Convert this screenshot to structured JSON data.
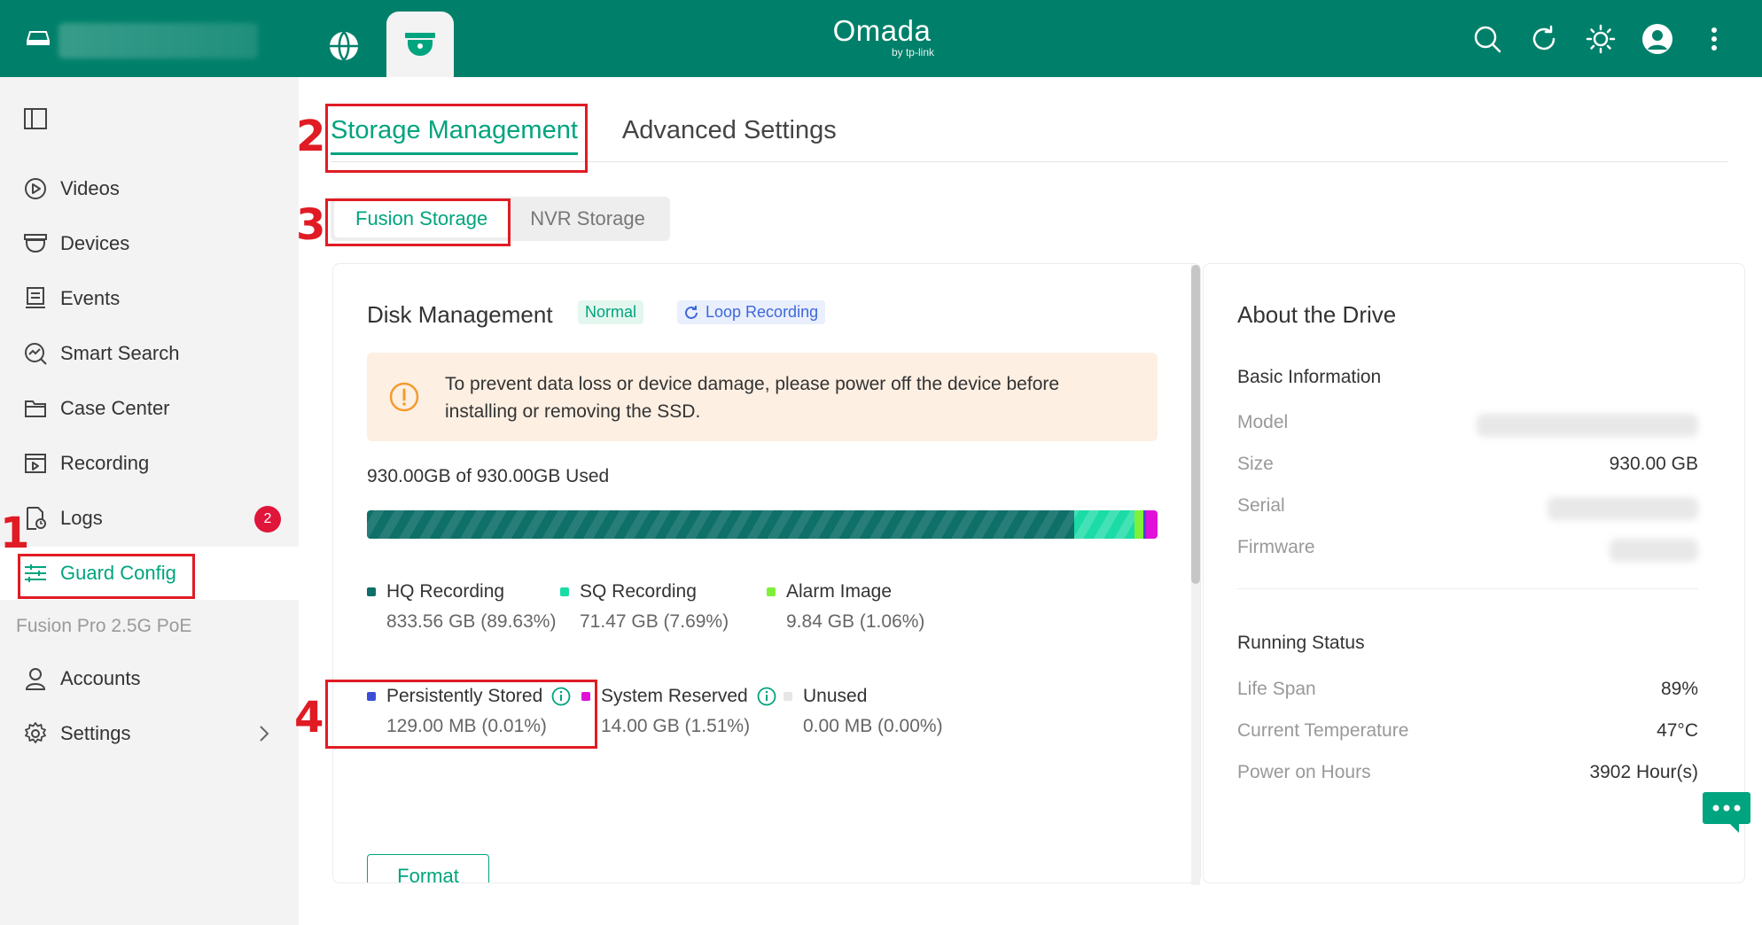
{
  "colors": {
    "topbar": "#00806a",
    "accent": "#00a47e",
    "warning": "#f39b2c",
    "badge": "#e0153a",
    "hq": "#0f6f69",
    "sq": "#1bdba6",
    "alarm": "#7ef03a",
    "persist": "#3a4fd6",
    "sys": "#e010d9",
    "unused": "#eeeeee"
  },
  "header": {
    "brand": "Omada",
    "brand_by": "by tp-link",
    "icons": [
      "site-icon",
      "globe-icon",
      "guard-icon",
      "search-icon",
      "refresh-icon",
      "theme-icon",
      "avatar",
      "more-icon"
    ]
  },
  "sidebar": {
    "items": [
      {
        "label": "Videos",
        "icon": "play-icon"
      },
      {
        "label": "Devices",
        "icon": "camera-icon"
      },
      {
        "label": "Events",
        "icon": "events-icon"
      },
      {
        "label": "Smart Search",
        "icon": "smart-search-icon"
      },
      {
        "label": "Case Center",
        "icon": "folder-icon"
      },
      {
        "label": "Recording",
        "icon": "recording-icon"
      },
      {
        "label": "Logs",
        "icon": "logs-icon",
        "badge": "2"
      },
      {
        "label": "Guard Config",
        "icon": "config-icon",
        "active": true
      }
    ],
    "section": "Fusion Pro 2.5G PoE",
    "section_items": [
      {
        "label": "Accounts",
        "icon": "user-icon"
      },
      {
        "label": "Settings",
        "icon": "gear-icon"
      }
    ]
  },
  "tabs": [
    {
      "label": "Storage Management",
      "active": true
    },
    {
      "label": "Advanced Settings",
      "active": false
    }
  ],
  "subtabs": [
    {
      "label": "Fusion Storage",
      "active": true
    },
    {
      "label": "NVR Storage",
      "active": false
    }
  ],
  "disk": {
    "title": "Disk Management",
    "status": "Normal",
    "mode": "Loop Recording",
    "warning": "To prevent data loss or device damage, please power off the device before installing or removing the SSD.",
    "used_text": "930.00GB of 930.00GB Used",
    "segments": [
      {
        "key": "hq",
        "label": "HQ Recording",
        "value": "833.56 GB (89.63%)",
        "percent": 89.63,
        "color": "#0f6f69"
      },
      {
        "key": "sq",
        "label": "SQ Recording",
        "value": "71.47 GB (7.69%)",
        "percent": 7.69,
        "color": "#1bdba6"
      },
      {
        "key": "alarm",
        "label": "Alarm Image",
        "value": "9.84 GB (1.06%)",
        "percent": 1.06,
        "color": "#7ef03a"
      },
      {
        "key": "persist",
        "label": "Persistently Stored",
        "value": "129.00 MB (0.01%)",
        "percent": 0.01,
        "color": "#3a4fd6"
      },
      {
        "key": "sys",
        "label": "System Reserved",
        "value": "14.00 GB (1.51%)",
        "percent": 1.51,
        "color": "#e010d9"
      },
      {
        "key": "unused",
        "label": "Unused",
        "value": "0.00 MB (0.00%)",
        "percent": 0.0,
        "color": "#eeeeee"
      }
    ],
    "format_label": "Format"
  },
  "drive": {
    "title": "About the Drive",
    "basic_title": "Basic Information",
    "basic": [
      {
        "key": "Model",
        "value": ""
      },
      {
        "key": "Size",
        "value": "930.00 GB"
      },
      {
        "key": "Serial",
        "value": ""
      },
      {
        "key": "Firmware",
        "value": ""
      }
    ],
    "running_title": "Running Status",
    "running": [
      {
        "key": "Life Span",
        "value": "89%"
      },
      {
        "key": "Current Temperature",
        "value": "47°C"
      },
      {
        "key": "Power on Hours",
        "value": "3902 Hour(s)"
      }
    ]
  },
  "annotations": [
    "1",
    "2",
    "3",
    "4"
  ]
}
